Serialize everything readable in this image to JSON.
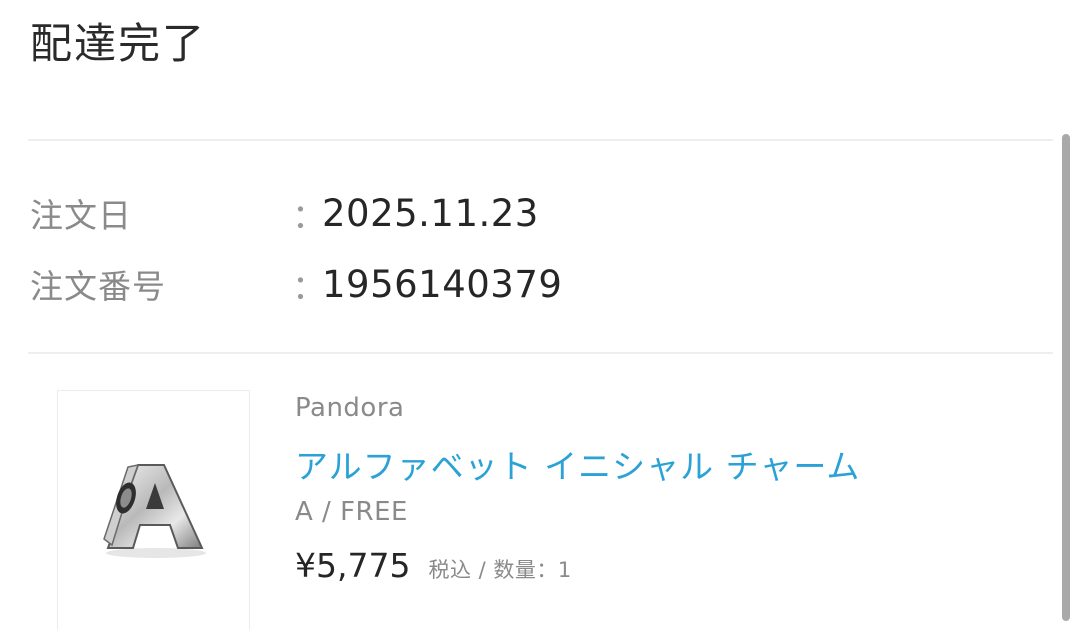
{
  "order": {
    "status_title": "配達完了",
    "date_label": "注文日",
    "date_colon": "：",
    "date_value": "2025.11.23",
    "number_label": "注文番号",
    "number_colon": "：",
    "number_value": "1956140379"
  },
  "product": {
    "brand": "Pandora",
    "name": "アルファベット イニシャル チャーム",
    "variant": "A / FREE",
    "price": "¥5,775",
    "price_note": "税込 / 数量：1",
    "image_icon": "letter-a-charm-icon"
  },
  "colors": {
    "link": "#2aa2d6",
    "label": "#8a8a8a",
    "text": "#262626",
    "divider": "#eeeeee"
  }
}
